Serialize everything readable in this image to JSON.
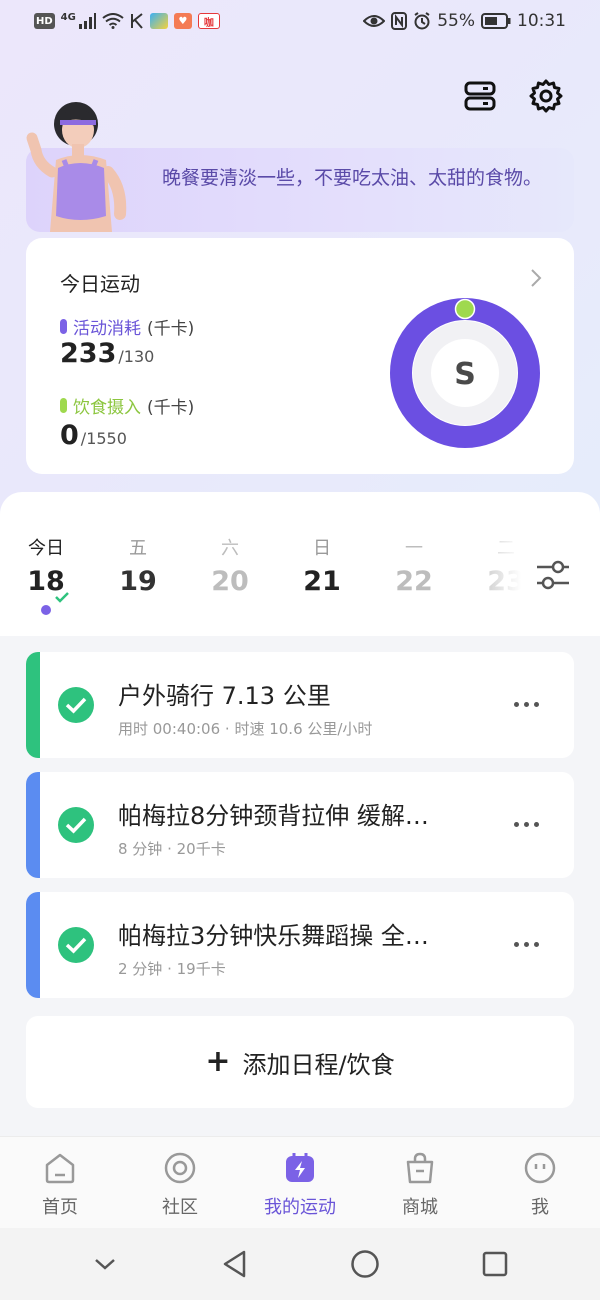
{
  "status_bar": {
    "left_chips": [
      "HD",
      "4G"
    ],
    "app_badge_3": "咖",
    "battery": "55%",
    "time": "10:31"
  },
  "colors": {
    "accent": "#6a55d8",
    "ring": "#6b4fe2",
    "activity_dot": "#7b62e6",
    "diet_dot": "#9fd94e",
    "green_check": "#2ec27e",
    "bar_green": "#2ec27e",
    "bar_blue": "#5b8cf1"
  },
  "header": {
    "icons": [
      "server-icon",
      "gear-icon"
    ]
  },
  "tip": {
    "text": "晚餐要清淡一些，不要吃太油、太甜的食物。"
  },
  "today": {
    "title": "今日运动",
    "activity": {
      "label": "活动消耗",
      "unit": "(千卡)",
      "value": "233",
      "goal": "/130"
    },
    "diet": {
      "label": "饮食摄入",
      "unit": "(千卡)",
      "value": "0",
      "goal": "/1550"
    },
    "ring_letter": "S",
    "ring_progress": 1.0
  },
  "days": [
    {
      "weekday": "今日",
      "num": "18"
    },
    {
      "weekday": "五",
      "num": "19"
    },
    {
      "weekday": "六",
      "num": "20"
    },
    {
      "weekday": "日",
      "num": "21"
    },
    {
      "weekday": "一",
      "num": "22"
    },
    {
      "weekday": "二",
      "num": "23"
    }
  ],
  "activities": [
    {
      "title": "户外骑行 7.13 公里",
      "sub": "用时 00:40:06 · 时速 10.6 公里/小时"
    },
    {
      "title": "帕梅拉8分钟颈背拉伸 缓解…",
      "sub": "8 分钟 · 20千卡"
    },
    {
      "title": "帕梅拉3分钟快乐舞蹈操 全…",
      "sub": "2 分钟 · 19千卡"
    }
  ],
  "add_button": {
    "plus": "+",
    "label": "添加日程/饮食"
  },
  "nav": [
    {
      "label": "首页",
      "icon": "home-icon"
    },
    {
      "label": "社区",
      "icon": "community-icon"
    },
    {
      "label": "我的运动",
      "icon": "lightning-icon"
    },
    {
      "label": "商城",
      "icon": "bag-icon"
    },
    {
      "label": "我",
      "icon": "face-icon"
    }
  ]
}
